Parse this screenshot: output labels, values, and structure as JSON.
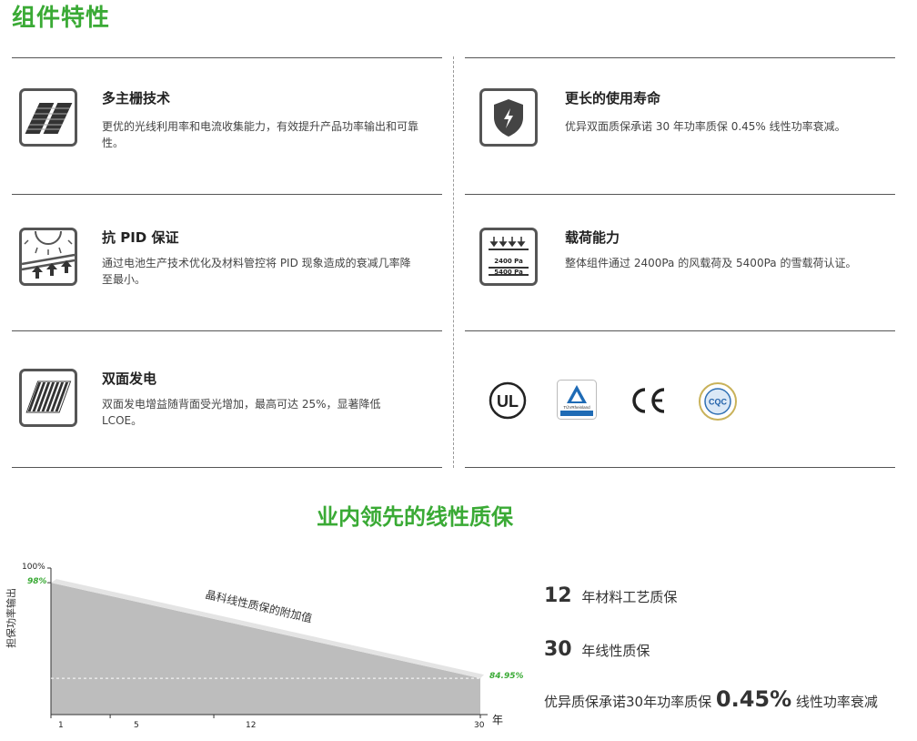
{
  "page_title": "组件特性",
  "features": [
    {
      "title": "多主栅技术",
      "desc": "更优的光线利用率和电流收集能力，有效提升产品功率输出和可靠性。",
      "icon": "multi-busbar-cell-icon"
    },
    {
      "title": "更长的使用寿命",
      "desc": "优异双面质保承诺 30 年功率质保 0.45% 线性功率衰减。",
      "icon": "shield-lightning-icon"
    },
    {
      "title": "抗 PID 保证",
      "desc": "通过电池生产技术优化及材料管控将 PID 现象造成的衰减几率降至最小。",
      "icon": "anti-pid-sun-icon"
    },
    {
      "title": "载荷能力",
      "desc": "整体组件通过 2400Pa 的风载荷及 5400Pa 的雪载荷认证。",
      "icon": "load-capacity-icon"
    },
    {
      "title": "双面发电",
      "desc": "双面发电增益随背面受光增加，最高可达 25%，显著降低 LCOE。",
      "icon": "bifacial-panel-icon"
    }
  ],
  "load_icon_labels": [
    "2400 Pa",
    "5400 Pa"
  ],
  "certifications": [
    {
      "name": "ul-certification-icon",
      "text": "UL"
    },
    {
      "name": "tuv-rheinland-icon",
      "text": "TÜVRheinland"
    },
    {
      "name": "ce-mark-icon",
      "text": "CE"
    },
    {
      "name": "cqc-certification-icon",
      "text": "CQC"
    }
  ],
  "warranty_section_title": "业内领先的线性质保",
  "chart_data": {
    "type": "area",
    "x_ticks": [
      "1",
      "5",
      "12",
      "30"
    ],
    "x_unit": "年",
    "y_top_label": "100%",
    "y_axis_label": "担保功率输出",
    "start_value_label": "98%",
    "end_value_label": "84.95%",
    "annotation": "晶科线性质保的附加值",
    "series": [
      {
        "x": [
          1,
          30
        ],
        "y": [
          98,
          84.95
        ]
      }
    ],
    "colors": {
      "area": "#bdbdbd",
      "highlight": "#e6e6e6",
      "value_label": "#3aaa35"
    }
  },
  "warranty_items": [
    {
      "number": "12",
      "text": "年材料工艺质保"
    },
    {
      "number": "30",
      "text": "年线性质保"
    },
    {
      "prefix": "优异质保承诺30年功率质保",
      "number": "0.45%",
      "suffix": "线性功率衰减"
    }
  ]
}
